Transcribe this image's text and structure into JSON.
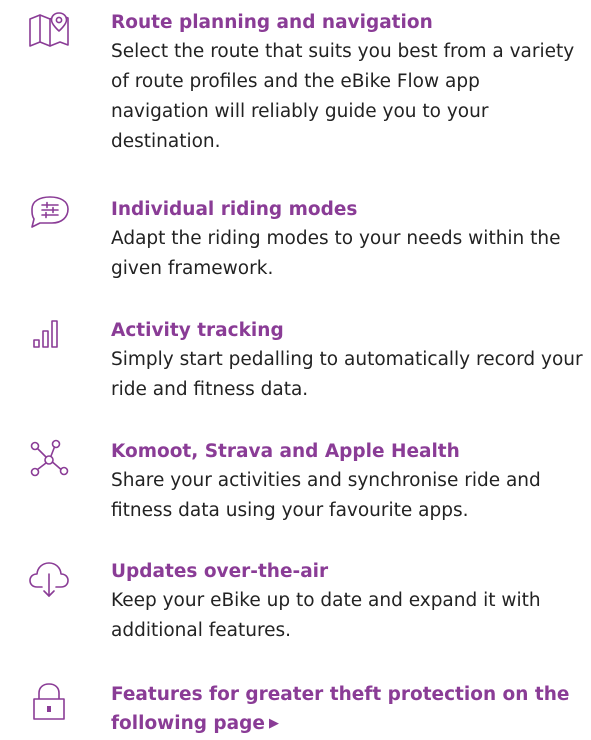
{
  "colors": {
    "accent": "#8a3c96",
    "text": "#222222",
    "icon": "#8a3c96"
  },
  "features": [
    {
      "icon": "map-pin-icon",
      "title": "Route planning and navigation",
      "description": "Select the route that suits you best from a variety of route profiles and the eBike Flow app navigation will reliably guide you to your destination."
    },
    {
      "icon": "riding-modes-icon",
      "title": "Individual riding modes",
      "description": "Adapt the riding modes to your needs within the given framework."
    },
    {
      "icon": "bar-chart-icon",
      "title": "Activity tracking",
      "description": "Simply start pedalling to automatically record your ride and fitness data."
    },
    {
      "icon": "network-icon",
      "title": "Komoot, Strava and Apple Health",
      "description": "Share your activities and synchronise ride and fitness data using your favourite apps."
    },
    {
      "icon": "cloud-download-icon",
      "title": "Updates over-the-air",
      "description": "Keep your eBike up to date and expand it with additional features."
    },
    {
      "icon": "lock-icon",
      "title": "Features for greater theft protection on the following page",
      "arrow": "▶"
    }
  ]
}
